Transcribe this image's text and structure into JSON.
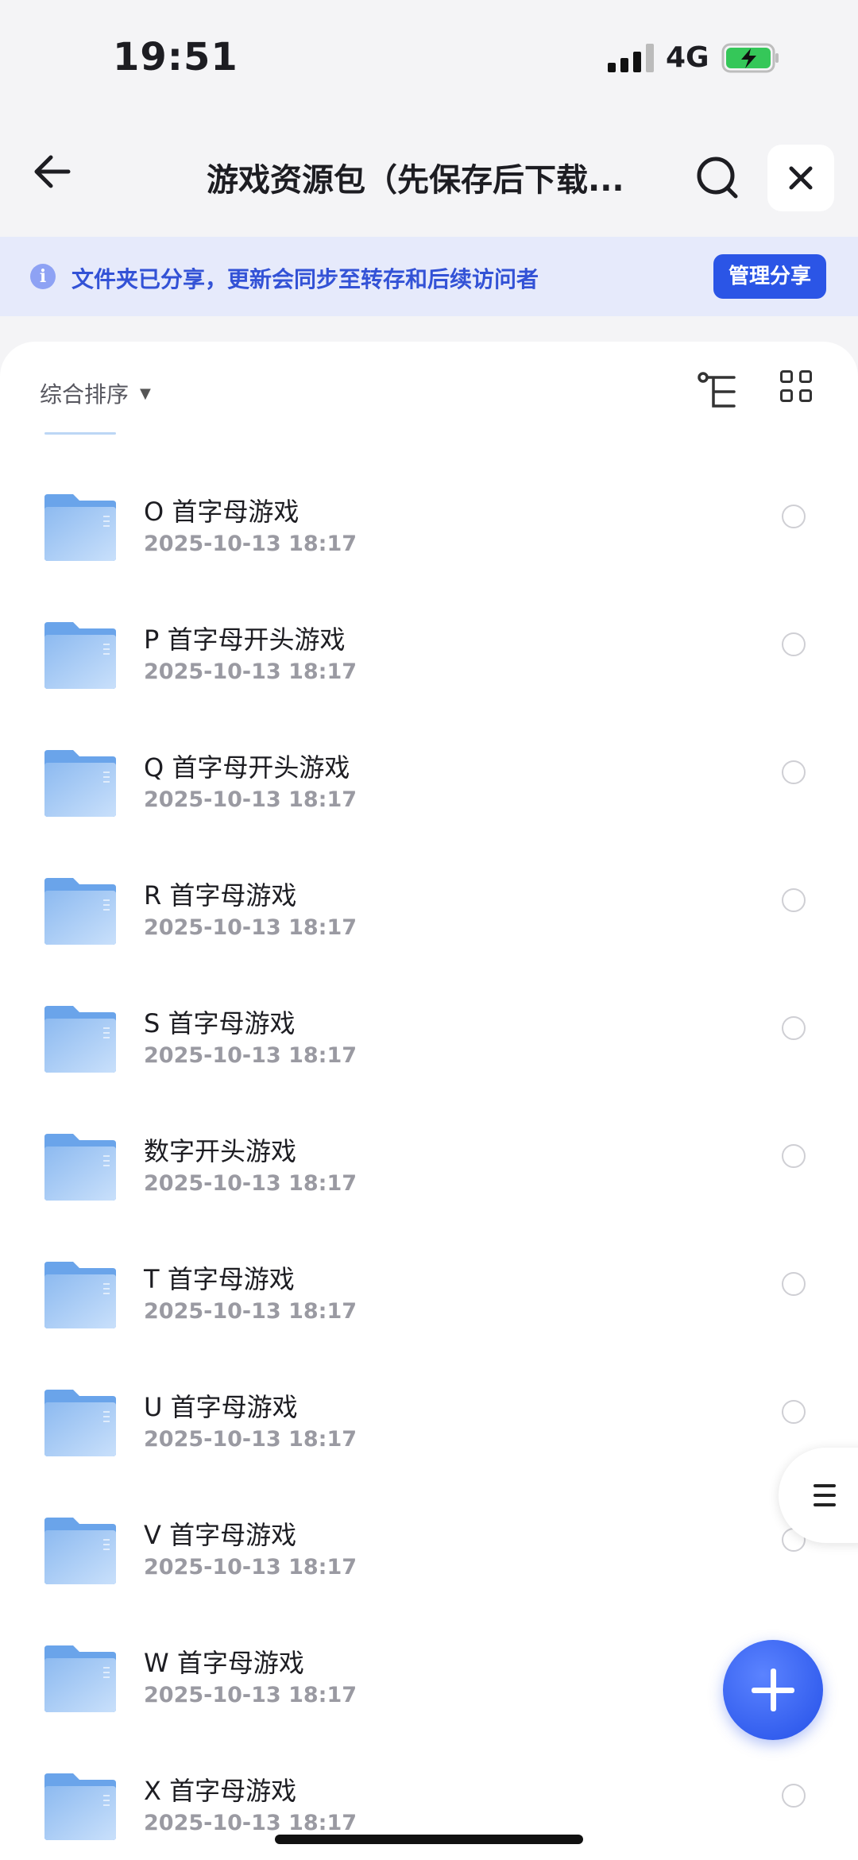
{
  "status_bar": {
    "time": "19:51",
    "network": "4G"
  },
  "header": {
    "title": "游戏资源包（先保存后下载..."
  },
  "notice": {
    "text": "文件夹已分享，更新会同步至转存和后续访问者",
    "button_label": "管理分享"
  },
  "toolbar": {
    "sort_label": "综合排序"
  },
  "files": [
    {
      "name": "O 首字母游戏",
      "date": "2025-10-13 18:17"
    },
    {
      "name": "P 首字母开头游戏",
      "date": "2025-10-13 18:17"
    },
    {
      "name": "Q 首字母开头游戏",
      "date": "2025-10-13 18:17"
    },
    {
      "name": "R 首字母游戏",
      "date": "2025-10-13 18:17"
    },
    {
      "name": "S 首字母游戏",
      "date": "2025-10-13 18:17"
    },
    {
      "name": "数字开头游戏",
      "date": "2025-10-13 18:17"
    },
    {
      "name": "T 首字母游戏",
      "date": "2025-10-13 18:17"
    },
    {
      "name": "U 首字母游戏",
      "date": "2025-10-13 18:17"
    },
    {
      "name": "V 首字母游戏",
      "date": "2025-10-13 18:17"
    },
    {
      "name": "W 首字母游戏",
      "date": "2025-10-13 18:17"
    },
    {
      "name": "X 首字母游戏",
      "date": "2025-10-13 18:17"
    }
  ],
  "icons": {
    "back": "arrow-left-icon",
    "search": "search-icon",
    "close": "close-icon",
    "info": "info-icon",
    "tree": "tree-view-icon",
    "grid": "grid-view-icon",
    "folder": "folder-icon",
    "menu": "menu-icon",
    "add": "plus-icon"
  },
  "colors": {
    "accent": "#2b55e6",
    "notice_bg": "#e6eafb",
    "folder": "#8fbdf0",
    "battery": "#35c759"
  }
}
